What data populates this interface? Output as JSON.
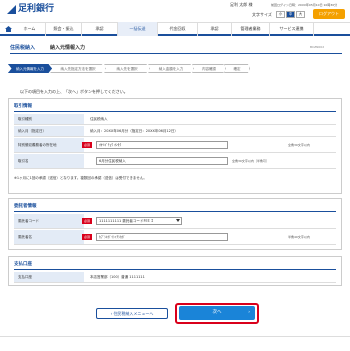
{
  "header": {
    "bank_name": "足利銀行",
    "user_label": "足利 太郎 様",
    "last_login": "前回ログイン日時：20XX年05月10日 10時30分",
    "font_size_label": "文字サイズ",
    "font_size_options": [
      "小",
      "中",
      "大"
    ],
    "logout_label": "ログアウト"
  },
  "nav": {
    "items": [
      {
        "label": "ホーム"
      },
      {
        "label": "照会・振込"
      },
      {
        "label": "承認"
      },
      {
        "label": "一括伝送"
      },
      {
        "label": "代金回収"
      },
      {
        "label": "承認"
      },
      {
        "label": "管理者業務"
      },
      {
        "label": "サービス連携"
      }
    ]
  },
  "page": {
    "title": "住民税納入",
    "subtitle": "納入元情報入力",
    "screen_id": "BCZN002",
    "instruction": "以下の項目を入力の上、「次へ」ボタンを押してください。"
  },
  "steps": [
    {
      "label": "納入元情報を入力"
    },
    {
      "label": "納入先指定方法を選択"
    },
    {
      "label": "納入先を選択"
    },
    {
      "label": "納入金額を入力"
    },
    {
      "label": "内容確認"
    },
    {
      "label": "確定"
    }
  ],
  "transaction": {
    "title": "取引情報",
    "rows": [
      {
        "label": "取引種別",
        "value": "住民税納入"
      },
      {
        "label": "納入月（指定日）",
        "value": "納入月：20XX年06月分（指定日：20XX年06月12日）"
      },
      {
        "label": "特別徴収義務者の所在地",
        "required": "必須",
        "input": "ｵｵﾂｷﾞﾁｮｳ ｵﾝﾀｸ",
        "hint": "全角30文字以内"
      },
      {
        "label": "取引名",
        "input": "6月分住民税納入",
        "hint": "全角30文字以内［半角可］"
      }
    ],
    "note": "※1ヶ月に1回の承認（送信）となります。複数回の承認（送信）は受付できません。"
  },
  "consignor": {
    "title": "委託者情報",
    "rows": [
      {
        "label": "委託者コード",
        "required": "必須",
        "select": "1111111111 委託者コードＭＥＩ"
      },
      {
        "label": "委託者名",
        "required": "必須",
        "input": "ｶﾌﾞｼｷｶﾞｲｼｬｱｼｶｶﾞ",
        "hint": "半角40文字以内"
      }
    ]
  },
  "account": {
    "title": "支払口座",
    "rows": [
      {
        "label": "支払口座",
        "value": "本店営業部（100）普通 1111111"
      }
    ]
  },
  "actions": {
    "back_label": "住民税納入メニューへ",
    "next_label": "次へ"
  },
  "colors": {
    "brand": "#1a4f9c",
    "next_button": "#1a84d8",
    "logout": "#f4a000",
    "required": "#d9001b",
    "highlight_ring": "#d9001b"
  }
}
